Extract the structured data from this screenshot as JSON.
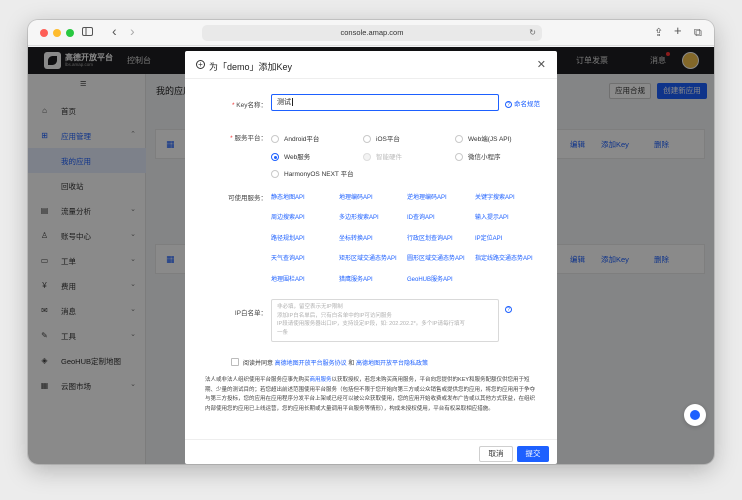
{
  "browser": {
    "url": "console.amap.com",
    "nav_back": "‹",
    "nav_forward": "›",
    "reload": "↻",
    "share": "⇪",
    "new_tab": "+",
    "tabs": "⧉"
  },
  "header": {
    "logo_title": "高德开放平台",
    "logo_sub": "lbs.amap.com",
    "console": "控制台",
    "nav_orders": "订单发票",
    "nav_messages": "消息"
  },
  "sidebar": {
    "menu_icon": "≡",
    "items": [
      {
        "label": "首页",
        "icon": "home-icon"
      },
      {
        "label": "应用管理",
        "icon": "grid-icon"
      },
      {
        "label": "我的应用",
        "icon": ""
      },
      {
        "label": "回收站",
        "icon": ""
      },
      {
        "label": "流量分析",
        "icon": "chart-icon"
      },
      {
        "label": "账号中心",
        "icon": "user-icon"
      },
      {
        "label": "工单",
        "icon": "ticket-icon"
      },
      {
        "label": "费用",
        "icon": "fee-icon"
      },
      {
        "label": "消息",
        "icon": "message-icon"
      },
      {
        "label": "工具",
        "icon": "tool-icon"
      },
      {
        "label": "GeoHUB定制地图",
        "icon": "geohub-icon"
      },
      {
        "label": "云图市场",
        "icon": "market-icon"
      }
    ]
  },
  "main": {
    "title": "我的应用",
    "btn_compliance": "应用合规",
    "btn_create": "创建新应用",
    "card_actions": {
      "edit": "编辑",
      "add_key": "添加Key",
      "delete": "删除"
    }
  },
  "modal": {
    "title": "为「demo」添加Key",
    "key_name_label": "Key名称：",
    "key_name_value": "测试",
    "naming_rules": "命名规范",
    "platform_label": "服务平台：",
    "platforms": [
      {
        "label": "Android平台",
        "checked": false,
        "disabled": false
      },
      {
        "label": "iOS平台",
        "checked": false,
        "disabled": false
      },
      {
        "label": "Web端(JS API)",
        "checked": false,
        "disabled": false
      },
      {
        "label": "Web服务",
        "checked": true,
        "disabled": false
      },
      {
        "label": "智能硬件",
        "checked": false,
        "disabled": true
      },
      {
        "label": "微信小程序",
        "checked": false,
        "disabled": false
      },
      {
        "label": "HarmonyOS NEXT 平台",
        "checked": false,
        "disabled": false
      }
    ],
    "services_label": "可使用服务：",
    "services": [
      "静态地图API",
      "地理编码API",
      "逆地理编码API",
      "关键字搜索API",
      "周边搜索API",
      "多边形搜索API",
      "ID查询API",
      "输入提示API",
      "路径规划API",
      "坐标转换API",
      "行政区划查询API",
      "IP定位API",
      "天气查询API",
      "矩形区域交通态势API",
      "圆形区域交通态势API",
      "指定线路交通态势API",
      "地理围栏API",
      "猎鹰服务API",
      "GeoHUB服务API"
    ],
    "ip_label": "IP白名单：",
    "ip_placeholder_lines": [
      "非必填，留空表示无IP限制",
      "添加IP白名单后，只有白名单中的IP可访问服务",
      "IP段请使用服务器出口IP，支持设定IP段，如: 202.202.2*。多个IP请每行填写",
      "一条"
    ],
    "agree_prefix": "阅读并同意 ",
    "agree_link1": "高德地图开放平台服务协议",
    "agree_mid": " 和 ",
    "agree_link2": "高德地图开放平台隐私政策",
    "legal_before": "法人或非法人组织使用平台服务应事先购买",
    "legal_link": "商用服务",
    "legal_after": "以获取授权，若您未购买商用服务，平台向您提供的KEY和服务配额仅供您用于短期、少量的测试目的；若您超出前述范围使用平台服务（包括但不限于您开始向第三方或公众销售或提供您的应用，将您的应用用于争夺与第三方投标，您的应用在应用程序分发平台上架或已经可以被公众获取使用，您的应用开始收费或发布广告或以其他方式获益，在组织内部使用您的应用已上线运营，您的应用长期或大量调用平台服务等情形），构成未授权使用，平台有权采取相应措施。",
    "cancel": "取消",
    "submit": "提交"
  }
}
